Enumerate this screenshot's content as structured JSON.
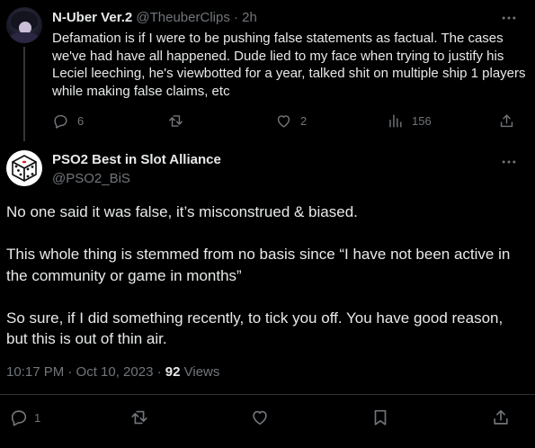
{
  "reply_tweet": {
    "display_name": "N-Uber Ver.2",
    "handle": "@TheuberClips",
    "separator": "·",
    "time": "2h",
    "text": "Defamation is if I were to be pushing false statements as factual. The cases we've had have all happened. Dude lied to my face when trying to justify his Leciel leeching, he's viewbotted for a year, talked shit on multiple ship 1 players while making false claims, etc",
    "replies": "6",
    "reposts": "",
    "likes": "2",
    "views": "156"
  },
  "main_tweet": {
    "display_name": "PSO2 Best in Slot Alliance",
    "handle": "@PSO2_BiS",
    "paragraphs": [
      "No one said it was false, it’s misconstrued & biased.",
      "This whole thing is stemmed from no basis since “I have not been active in the community or game in months”",
      "So sure, if I did something recently, to tick you off. You have good reason, but this is out of thin air."
    ],
    "timestamp": "10:17 PM · Oct 10, 2023",
    "meta_separator": " · ",
    "views_count": "92",
    "views_label": " Views",
    "replies": "1"
  },
  "icons": {
    "more": "more-horizontal-icon",
    "reply": "speech-bubble-icon",
    "repost": "repost-arrows-icon",
    "like": "heart-icon",
    "views": "bar-chart-icon",
    "bookmark": "bookmark-icon",
    "share": "share-upload-icon"
  },
  "colors": {
    "background": "#000000",
    "text_primary": "#e7e9ea",
    "text_secondary": "#71767b",
    "divider": "#2f3336"
  }
}
